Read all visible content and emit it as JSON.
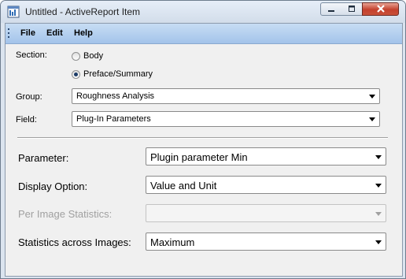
{
  "window": {
    "title": "Untitled - ActiveReport Item",
    "icon": "report-item-icon",
    "controls": {
      "minimize": "minimize-icon",
      "maximize": "maximize-icon",
      "close": "close-icon"
    }
  },
  "menu": {
    "file": "File",
    "edit": "Edit",
    "help": "Help"
  },
  "section": {
    "label": "Section:",
    "options": [
      {
        "label": "Body",
        "selected": false
      },
      {
        "label": "Preface/Summary",
        "selected": true
      }
    ]
  },
  "group": {
    "label": "Group:",
    "value": "Roughness Analysis"
  },
  "field": {
    "label": "Field:",
    "value": "Plug-In Parameters"
  },
  "parameter": {
    "label": "Parameter:",
    "value": "Plugin parameter Min"
  },
  "display_option": {
    "label": "Display Option:",
    "value": "Value and Unit"
  },
  "per_image_stats": {
    "label": "Per Image Statistics:",
    "value": "",
    "enabled": false
  },
  "stats_across_images": {
    "label": "Statistics across Images:",
    "value": "Maximum"
  },
  "colors": {
    "menubar": "#a3c3ea",
    "close_button": "#c4412d",
    "panel": "#f0f0f0"
  }
}
